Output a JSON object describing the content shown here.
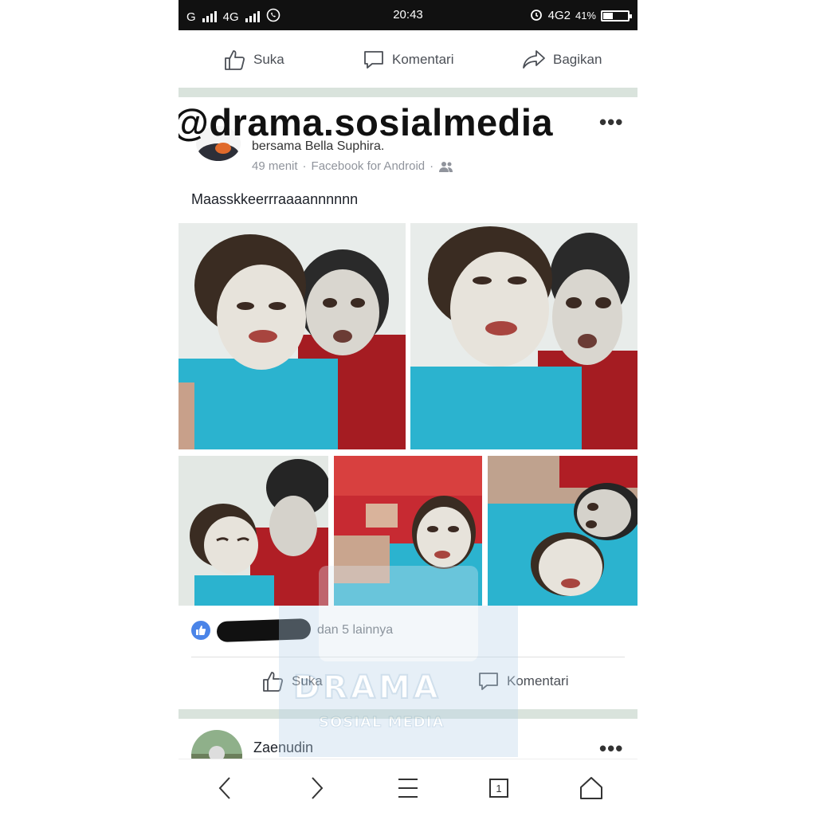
{
  "status_bar": {
    "carrier1": "G",
    "carrier2": "4G",
    "time": "20:43",
    "network": "4G2",
    "battery": "41%",
    "battery_level": 0.41
  },
  "top_actions": {
    "like": "Suka",
    "comment": "Komentari",
    "share": "Bagikan"
  },
  "post": {
    "watermark_handle": "@drama.sosialmedia",
    "with_text": "bersama Bella Suphira.",
    "time": "49 menit",
    "source": "Facebook for Android",
    "separator": "·",
    "body": "Maasskkeerrraaaannnnnn",
    "reactions_text": "dan 5 lainnya",
    "like_label": "Suka",
    "comment_label": "Komentari"
  },
  "next_post": {
    "author": "Zaenudin"
  },
  "nav": {
    "tab_count": "1"
  },
  "overlay": {
    "brand": "DRAMA",
    "sub": "SOSIAL MEDIA"
  },
  "colors": {
    "status_bg": "#111111",
    "divider": "#d9e3dc",
    "like_blue": "#4a84e8",
    "muted": "#90949c"
  }
}
